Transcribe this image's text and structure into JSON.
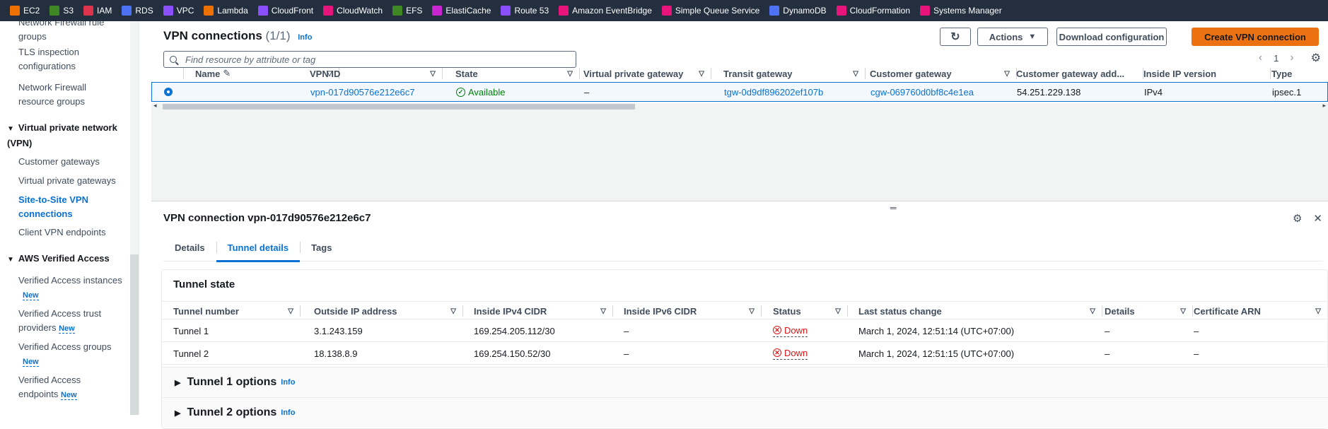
{
  "favorites": [
    {
      "label": "EC2",
      "icon": "ec2-icon",
      "color": "#ed7100"
    },
    {
      "label": "S3",
      "icon": "s3-icon",
      "color": "#3f8624"
    },
    {
      "label": "IAM",
      "icon": "iam-icon",
      "color": "#dd344c"
    },
    {
      "label": "RDS",
      "icon": "rds-icon",
      "color": "#4d72f3"
    },
    {
      "label": "VPC",
      "icon": "vpc-icon",
      "color": "#8c4fff"
    },
    {
      "label": "Lambda",
      "icon": "lambda-icon",
      "color": "#ed7100"
    },
    {
      "label": "CloudFront",
      "icon": "cloudfront-icon",
      "color": "#8c4fff"
    },
    {
      "label": "CloudWatch",
      "icon": "cloudwatch-icon",
      "color": "#e7157b"
    },
    {
      "label": "EFS",
      "icon": "efs-icon",
      "color": "#3f8624"
    },
    {
      "label": "ElastiCache",
      "icon": "elasticache-icon",
      "color": "#c925d1"
    },
    {
      "label": "Route 53",
      "icon": "route53-icon",
      "color": "#8c4fff"
    },
    {
      "label": "Amazon EventBridge",
      "icon": "eventbridge-icon",
      "color": "#e7157b"
    },
    {
      "label": "Simple Queue Service",
      "icon": "sqs-icon",
      "color": "#e7157b"
    },
    {
      "label": "DynamoDB",
      "icon": "dynamodb-icon",
      "color": "#4d72f3"
    },
    {
      "label": "CloudFormation",
      "icon": "cloudformation-icon",
      "color": "#e7157b"
    },
    {
      "label": "Systems Manager",
      "icon": "systems-manager-icon",
      "color": "#e7157b"
    }
  ],
  "sidebar": {
    "items_top": [
      "Network Firewall rule groups",
      "TLS inspection configurations",
      "Network Firewall resource groups"
    ],
    "vpn_section": "Virtual private network (VPN)",
    "vpn_items": [
      "Customer gateways",
      "Virtual private gateways",
      "Site-to-Site VPN connections",
      "Client VPN endpoints"
    ],
    "verified_section": "AWS Verified Access",
    "verified_items": [
      "Verified Access instances",
      "Verified Access trust providers",
      "Verified Access groups",
      "Verified Access endpoints"
    ],
    "new_badge": "New"
  },
  "list": {
    "title": "VPN connections",
    "count": "(1/1)",
    "info": "Info",
    "buttons": {
      "refresh": "↻",
      "actions": "Actions",
      "download": "Download configuration",
      "create": "Create VPN connection"
    },
    "search_placeholder": "Find resource by attribute or tag",
    "page": "1",
    "columns": [
      "Name",
      "VPN ID",
      "State",
      "Virtual private gateway",
      "Transit gateway",
      "Customer gateway",
      "Customer gateway add...",
      "Inside IP version",
      "Type"
    ],
    "row": {
      "name": "",
      "vpn_id": "vpn-017d90576e212e6c7",
      "state": "Available",
      "vpg": "–",
      "tgw": "tgw-0d9df896202ef107b",
      "cgw": "cgw-069760d0bf8c4e1ea",
      "cgw_addr": "54.251.229.138",
      "ip_version": "IPv4",
      "type": "ipsec.1"
    }
  },
  "detail": {
    "title": "VPN connection vpn-017d90576e212e6c7",
    "tabs": [
      "Details",
      "Tunnel details",
      "Tags"
    ],
    "tunnel_state_title": "Tunnel state",
    "columns": [
      "Tunnel number",
      "Outside IP address",
      "Inside IPv4 CIDR",
      "Inside IPv6 CIDR",
      "Status",
      "Last status change",
      "Details",
      "Certificate ARN"
    ],
    "rows": [
      {
        "tunnel": "Tunnel 1",
        "outside_ip": "3.1.243.159",
        "ipv4_cidr": "169.254.205.112/30",
        "ipv6_cidr": "–",
        "status": "Down",
        "last_change": "March 1, 2024, 12:51:14 (UTC+07:00)",
        "details": "–",
        "cert": "–"
      },
      {
        "tunnel": "Tunnel 2",
        "outside_ip": "18.138.8.9",
        "ipv4_cidr": "169.254.150.52/30",
        "ipv6_cidr": "–",
        "status": "Down",
        "last_change": "March 1, 2024, 12:51:15 (UTC+07:00)",
        "details": "–",
        "cert": "–"
      }
    ],
    "options": [
      "Tunnel 1 options",
      "Tunnel 2 options"
    ],
    "info": "Info"
  },
  "colors": {
    "accent": "#0972d3",
    "primary_button": "#ec7211",
    "available": "#037f0c",
    "down": "#d91515",
    "topbar": "#232f3e"
  }
}
